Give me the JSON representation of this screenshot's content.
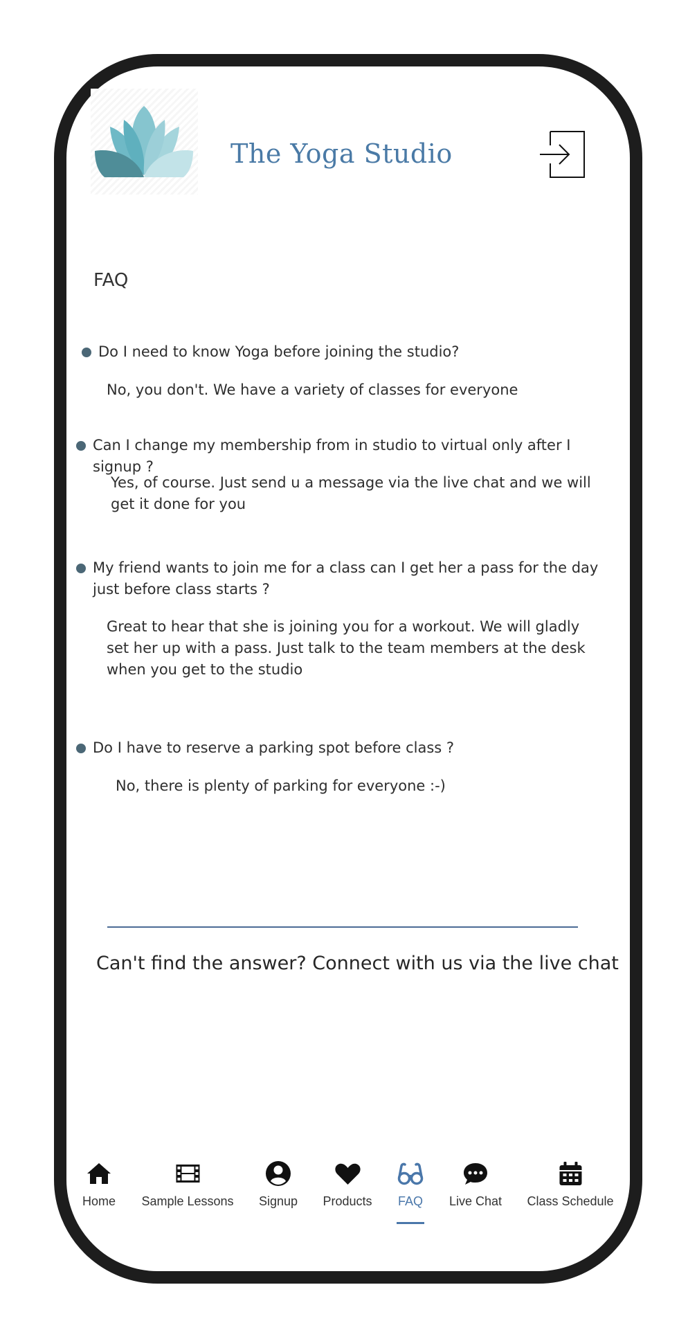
{
  "header": {
    "brand": "The Yoga Studio",
    "logo_icon": "lotus-logo-icon",
    "login_icon": "login-icon"
  },
  "page_title": "FAQ",
  "faq": [
    {
      "question": "Do I need to know Yoga before joining the studio?",
      "answer": "No, you don't. We have a variety of classes for everyone"
    },
    {
      "question": "Can I change my membership from in studio to virtual only after I signup ?",
      "answer": "Yes, of course. Just send u a message via the live chat and we will get it done for you"
    },
    {
      "question": "My friend wants to join me for a class can I get her a pass for the day just before class starts ?",
      "answer": "Great to hear that she is joining you for a workout. We will gladly set her up with a pass. Just talk to the team members at the desk when you get to the studio"
    },
    {
      "question": "Do I have to reserve a parking spot before class ?",
      "answer": "No, there is plenty of parking for everyone :-)"
    }
  ],
  "cta": "Can't find the answer? Connect with us via the live chat",
  "nav": [
    {
      "label": "Home",
      "icon": "home-icon"
    },
    {
      "label": "Sample Lessons",
      "icon": "film-icon"
    },
    {
      "label": "Signup",
      "icon": "user-circle-icon"
    },
    {
      "label": "Products",
      "icon": "heart-icon"
    },
    {
      "label": "FAQ",
      "icon": "glasses-icon",
      "active": true
    },
    {
      "label": "Live Chat",
      "icon": "chat-icon"
    },
    {
      "label": "Class Schedule",
      "icon": "calendar-icon"
    }
  ],
  "colors": {
    "accent": "#4a77aa",
    "brand": "#4a7aa6",
    "bullet": "#4b6776",
    "frame": "#1d1d1d"
  }
}
